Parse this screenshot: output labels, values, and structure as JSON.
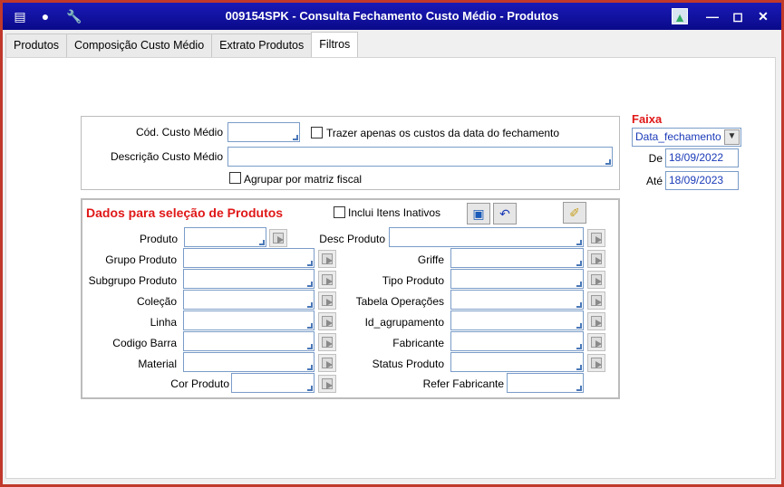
{
  "window": {
    "title": "009154SPK - Consulta Fechamento Custo Médio - Produtos"
  },
  "tabs": [
    {
      "label": "Produtos"
    },
    {
      "label": "Composição Custo Médio"
    },
    {
      "label": "Extrato Produtos"
    },
    {
      "label": "Filtros"
    }
  ],
  "filtros": {
    "cod_custo_label": "Cód. Custo Médio",
    "cod_custo_value": "",
    "trazer_label": "Trazer apenas os custos da data do fechamento",
    "descricao_label": "Descrição Custo Médio",
    "descricao_value": "",
    "agrupar_label": "Agrupar por matriz fiscal"
  },
  "faixa": {
    "title": "Faixa",
    "selected": "Data_fechamento",
    "de_label": "De",
    "de_value": "18/09/2022",
    "ate_label": "Até",
    "ate_value": "18/09/2023"
  },
  "produtos": {
    "section_title": "Dados para seleção de Produtos",
    "inativos_label": "Inclui Itens Inativos",
    "left_fields": [
      {
        "label": "Produto",
        "value": ""
      },
      {
        "label": "Grupo Produto",
        "value": ""
      },
      {
        "label": "Subgrupo Produto",
        "value": ""
      },
      {
        "label": "Coleção",
        "value": ""
      },
      {
        "label": "Linha",
        "value": ""
      },
      {
        "label": "Codigo Barra",
        "value": ""
      },
      {
        "label": "Material",
        "value": ""
      },
      {
        "label": "Cor Produto",
        "value": ""
      }
    ],
    "right_fields": [
      {
        "label": "Desc Produto",
        "value": ""
      },
      {
        "label": "Griffe",
        "value": ""
      },
      {
        "label": "Tipo Produto",
        "value": ""
      },
      {
        "label": "Tabela Operações",
        "value": ""
      },
      {
        "label": "Id_agrupamento",
        "value": ""
      },
      {
        "label": "Fabricante",
        "value": ""
      },
      {
        "label": "Status Produto",
        "value": ""
      },
      {
        "label": "Refer Fabricante",
        "value": ""
      }
    ]
  },
  "icons": {
    "menu": "menu-icon",
    "traffic_light": "traffic-light-icon",
    "tools": "wrench-icon",
    "picture": "picture-icon",
    "save": "save-icon",
    "undo": "undo-icon",
    "eraser": "eraser-icon"
  }
}
